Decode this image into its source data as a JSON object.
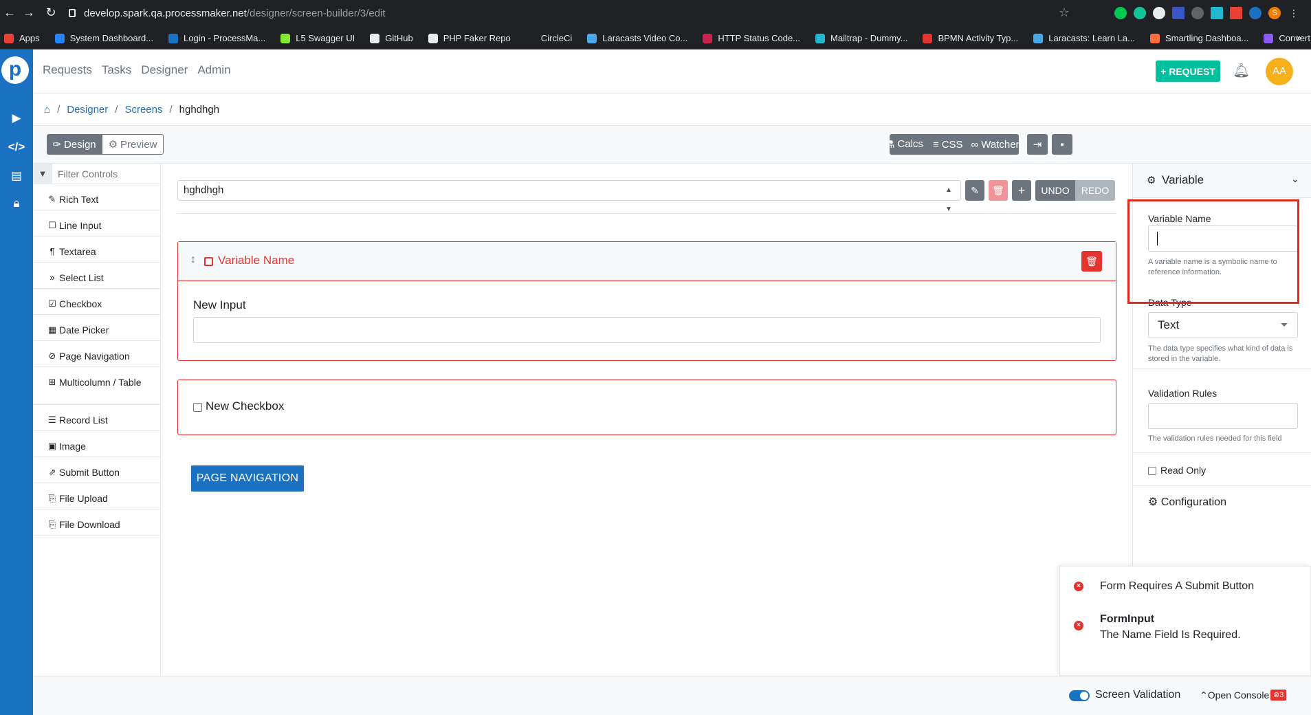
{
  "browser": {
    "url_host": "develop.spark.qa.processmaker.net",
    "url_path": "/designer/screen-builder/3/edit",
    "bookmarks": [
      {
        "label": "Apps",
        "color": "#e94235"
      },
      {
        "label": "System Dashboard...",
        "color": "#2684ff"
      },
      {
        "label": "Login - ProcessMa...",
        "color": "#1c72c2"
      },
      {
        "label": "L5 Swagger UI",
        "color": "#85ea2d"
      },
      {
        "label": "GitHub",
        "color": "#e8eaed"
      },
      {
        "label": "PHP Faker Repo",
        "color": "#e8eaed"
      },
      {
        "label": "CircleCi",
        "color": "#202124"
      },
      {
        "label": "Laracasts Video Co...",
        "color": "#4aa8e8"
      },
      {
        "label": "HTTP Status Code...",
        "color": "#c7254e"
      },
      {
        "label": "Mailtrap - Dummy...",
        "color": "#22b8cf"
      },
      {
        "label": "BPMN Activity Typ...",
        "color": "#e3342f"
      },
      {
        "label": "Laracasts: Learn La...",
        "color": "#4aa8e8"
      },
      {
        "label": "Smartling Dashboa...",
        "color": "#ff6f3c"
      },
      {
        "label": "Convert WEBM to...",
        "color": "#8a5cf6"
      }
    ],
    "more": "»",
    "profile_initial": "S"
  },
  "nav": {
    "links": [
      "Requests",
      "Tasks",
      "Designer",
      "Admin"
    ],
    "request_button": "+ REQUEST",
    "avatar": "AA"
  },
  "breadcrumb": {
    "items": [
      "Designer",
      "Screens"
    ],
    "current": "hghdhgh",
    "sep": "/"
  },
  "toolbar": {
    "design": "Design",
    "preview": "Preview",
    "calcs": "Calcs",
    "css": "CSS",
    "watchers": "Watchers"
  },
  "controls": {
    "filter_placeholder": "Filter Controls",
    "items": [
      {
        "label": "Rich Text",
        "icon": "✎"
      },
      {
        "label": "Line Input",
        "icon": "☐"
      },
      {
        "label": "Textarea",
        "icon": "¶"
      },
      {
        "label": "Select List",
        "icon": "»"
      },
      {
        "label": "Checkbox",
        "icon": "☑"
      },
      {
        "label": "Date Picker",
        "icon": "▦"
      },
      {
        "label": "Page Navigation",
        "icon": "⊘"
      },
      {
        "label": "Multicolumn / Table",
        "icon": "⊞"
      },
      {
        "label": "Record List",
        "icon": "☰"
      },
      {
        "label": "Image",
        "icon": "▣"
      },
      {
        "label": "Submit Button",
        "icon": "⇗"
      },
      {
        "label": "File Upload",
        "icon": "⎘"
      },
      {
        "label": "File Download",
        "icon": "⎘"
      }
    ]
  },
  "canvas": {
    "screen_name": "hghdhgh",
    "undo": "UNDO",
    "redo": "REDO",
    "variable_header": "Variable Name",
    "new_input_label": "New Input",
    "new_checkbox_label": "New Checkbox",
    "page_navigation_button": "PAGE NAVIGATION"
  },
  "inspector": {
    "section_title": "Variable",
    "variable_name_label": "Variable Name",
    "variable_name_value": "",
    "variable_name_help": "A variable name is a symbolic name to reference information.",
    "data_type_label": "Data Type",
    "data_type_value": "Text",
    "data_type_help": "The data type specifies what kind of data is stored in the variable.",
    "validation_label": "Validation Rules",
    "validation_help": "The validation rules needed for this field",
    "read_only_label": "Read Only",
    "configuration_label": "Configuration"
  },
  "errors": [
    {
      "title": "Form Requires A Submit Button",
      "detail": ""
    },
    {
      "title": "FormInput",
      "detail": "The Name Field Is Required."
    }
  ],
  "bottom": {
    "screen_validation": "Screen Validation",
    "open_console": "Open Console",
    "error_count": "3"
  },
  "colors": {
    "brand_blue": "#1c72c2",
    "success": "#00bf9c",
    "danger": "#e3342f",
    "avatar": "#f6b01c"
  }
}
